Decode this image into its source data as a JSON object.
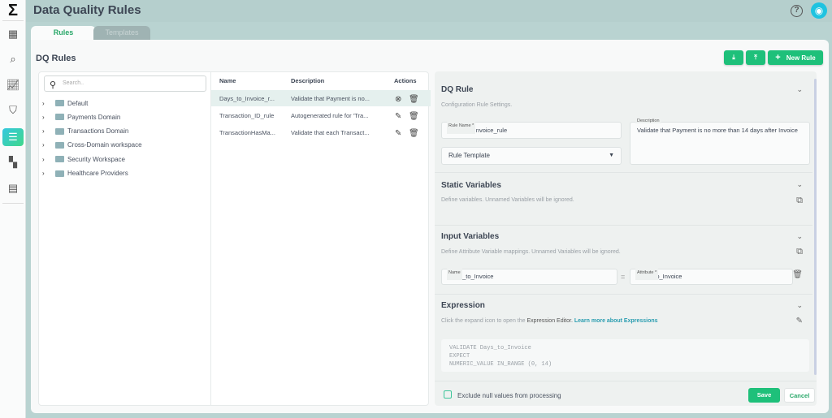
{
  "app": {
    "title": "Data Quality Rules",
    "logo": "Σ",
    "help_icon": "?"
  },
  "sidebar": {
    "items": [
      {
        "icon": "table-icon"
      },
      {
        "icon": "search-report-icon"
      },
      {
        "icon": "chart-icon"
      },
      {
        "icon": "shield-check-icon"
      },
      {
        "icon": "sliders-icon",
        "active": true
      },
      {
        "icon": "dashboard-icon"
      },
      {
        "icon": "document-icon"
      }
    ]
  },
  "tabs": [
    {
      "label": "Rules",
      "active": true
    },
    {
      "label": "Templates"
    }
  ],
  "page": {
    "title": "DQ Rules",
    "new_rule": "New Rule"
  },
  "search": {
    "placeholder": "Search.."
  },
  "tree": [
    "Default",
    "Payments Domain",
    "Transactions Domain",
    "Cross-Domain workspace",
    "Security Workspace",
    "Healthcare Providers"
  ],
  "table": {
    "headers": [
      "Name",
      "Description",
      "Actions"
    ],
    "rows": [
      {
        "name": "Days_to_Invoice_r...",
        "description": "Validate that Payment is no...",
        "selected": true
      },
      {
        "name": "Transaction_ID_rule",
        "description": "Autogenerated rule for 'Tra..."
      },
      {
        "name": "TransactionHasMa...",
        "description": "Validate that each Transact..."
      }
    ]
  },
  "rule": {
    "title": "DQ Rule",
    "subtitle": "Configuration Rule Settings.",
    "name_label": "Rule Name *",
    "name_value": "Days_to_Invoice_rule",
    "template_placeholder": "Rule Template",
    "desc_label": "Description",
    "desc_value": "Validate that Payment is no more than 14 days after Invoice"
  },
  "static": {
    "title": "Static Variables",
    "desc": "Define variables. Unnamed Variables will be ignored."
  },
  "input": {
    "title": "Input Variables",
    "desc": "Define Attribute Variable mappings. Unnamed Variables will be ignored.",
    "name_label": "Name",
    "name_value": "Days_to_Invoice",
    "eq": "=",
    "attr_label": "Attribute *",
    "attr_value": "Days_to_Invoice"
  },
  "expression": {
    "title": "Expression",
    "desc": "Click the expand icon to open the",
    "editor": "Expression Editor.",
    "link": "Learn more about Expressions",
    "code": [
      "VALIDATE Days_to_Invoice",
      "EXPECT",
      "NUMERIC_VALUE IN_RANGE (0, 14)"
    ]
  },
  "footer": {
    "checkbox_label": "Exclude null values from processing",
    "checked": false,
    "save": "Save",
    "cancel": "Cancel"
  },
  "colors": {
    "accent": "#1ec07a",
    "link": "#2a9db0",
    "header": "#b5cfcd"
  }
}
